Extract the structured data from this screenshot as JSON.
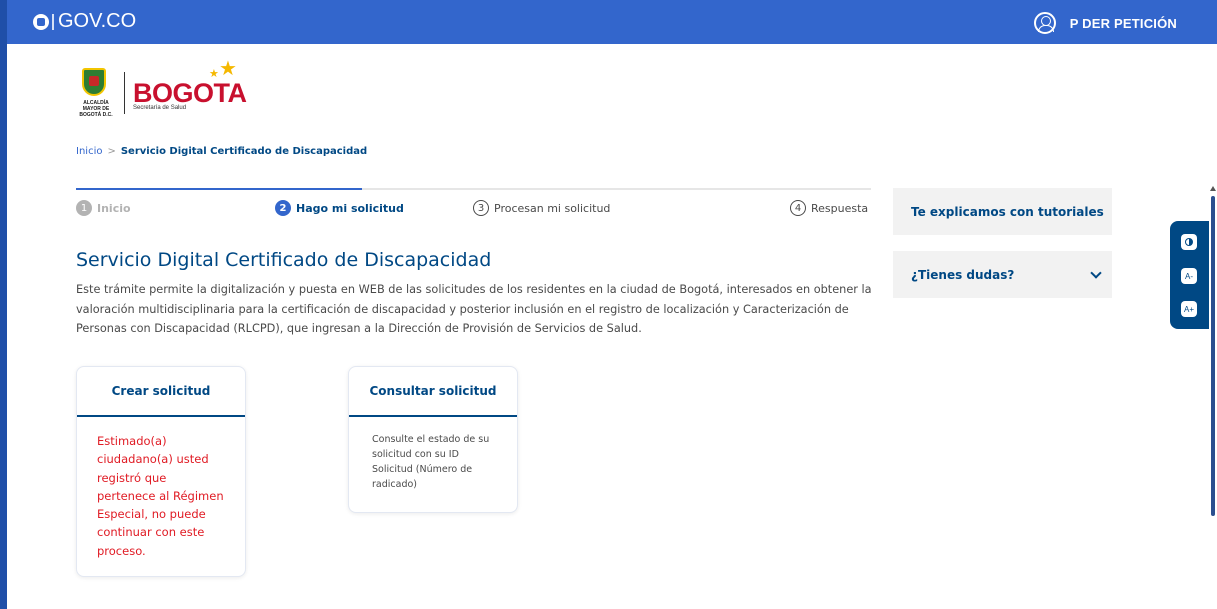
{
  "header": {
    "brand": "GOV.CO",
    "user_label": "P DER PETICIÓN"
  },
  "logo": {
    "alcaldia": "ALCALDÍA MAYOR DE BOGOTÁ D.C.",
    "city": "BOGOTA",
    "entity": "Secretaría de Salud"
  },
  "breadcrumb": {
    "home": "Inicio",
    "separator": ">",
    "current": "Servicio Digital Certificado de Discapacidad"
  },
  "stepper": {
    "progress_fraction": 0.36,
    "steps": [
      {
        "num": "1",
        "label": "Inicio",
        "state": "done"
      },
      {
        "num": "2",
        "label": "Hago mi solicitud",
        "state": "active"
      },
      {
        "num": "3",
        "label": "Procesan mi solicitud",
        "state": "todo"
      },
      {
        "num": "4",
        "label": "Respuesta",
        "state": "todo"
      }
    ]
  },
  "main": {
    "title": "Servicio Digital Certificado de Discapacidad",
    "description": "Este trámite permite la digitalización y puesta en WEB de las solicitudes de los residentes en la ciudad de Bogotá, interesados en obtener la valoración multidisciplinaria para la certificación de discapacidad y posterior inclusión en el registro de localización y Caracterización de Personas con Discapacidad (RLCPD), que ingresan a la Dirección de Provisión de Servicios de Salud."
  },
  "cards": {
    "create": {
      "title": "Crear solicitud",
      "message": "Estimado(a) ciudadano(a) usted registró que pertenece al Régimen Especial, no puede continuar con este proceso."
    },
    "consult": {
      "title": "Consultar solicitud",
      "text": "Consulte el estado de su solicitud con su ID Solicitud (Número de radicado)"
    }
  },
  "sidebar": {
    "tutorials": "Te explicamos con tutoriales",
    "doubts": "¿Tienes dudas?"
  },
  "accessibility": {
    "decrease": "A-",
    "increase": "A+"
  },
  "colors": {
    "top_bar": "#3366cc",
    "primary_dark": "#004884",
    "error_text": "#e01b24",
    "panel_bg": "#f2f2f2"
  }
}
